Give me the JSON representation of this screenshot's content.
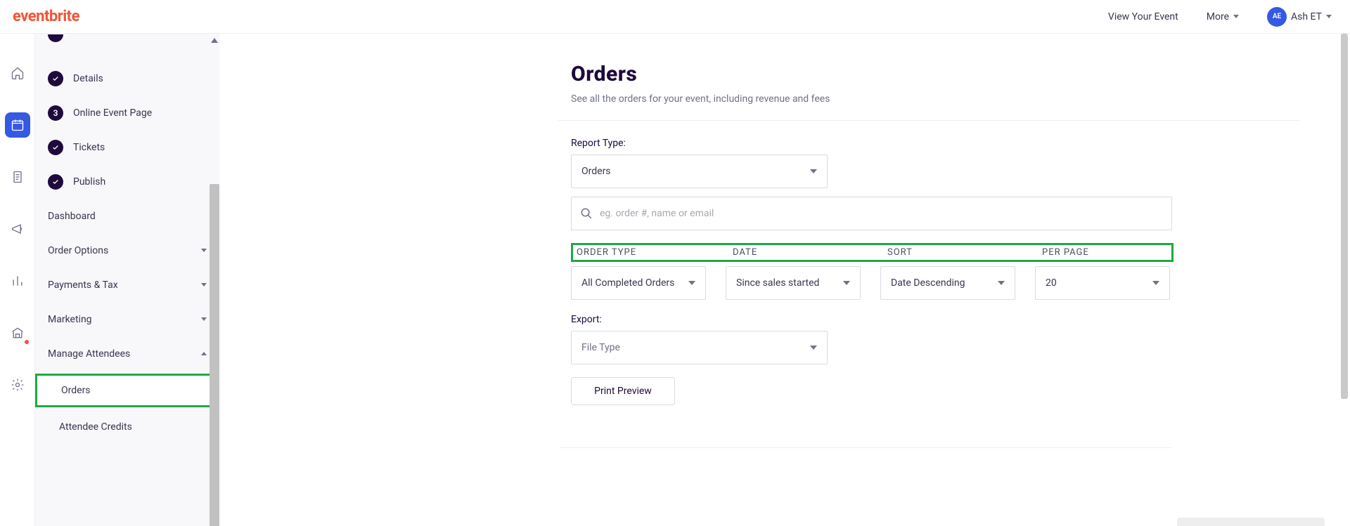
{
  "brand": "eventbrite",
  "topnav": {
    "view_event": "View Your Event",
    "more": "More",
    "user_initials": "AE",
    "user_name": "Ash ET"
  },
  "sidebar": {
    "steps": {
      "details": "Details",
      "online_num": "3",
      "online": "Online Event Page",
      "tickets": "Tickets",
      "publish": "Publish"
    },
    "items": {
      "dashboard": "Dashboard",
      "order_options": "Order Options",
      "payments_tax": "Payments & Tax",
      "marketing": "Marketing",
      "manage_attendees": "Manage Attendees"
    },
    "sub": {
      "orders": "Orders",
      "attendee_credits": "Attendee Credits"
    }
  },
  "page": {
    "title": "Orders",
    "subtitle": "See all the orders for your event, including revenue and fees",
    "report_type_label": "Report Type:",
    "report_type_value": "Orders",
    "search_placeholder": "eg. order #, name or email",
    "filter_labels": {
      "order_type": "ORDER TYPE",
      "date": "DATE",
      "sort": "SORT",
      "per_page": "PER PAGE"
    },
    "filters": {
      "order_type": "All Completed Orders",
      "date": "Since sales started",
      "sort": "Date Descending",
      "per_page": "20"
    },
    "export_label": "Export:",
    "export_value": "File Type",
    "print_preview": "Print Preview"
  }
}
